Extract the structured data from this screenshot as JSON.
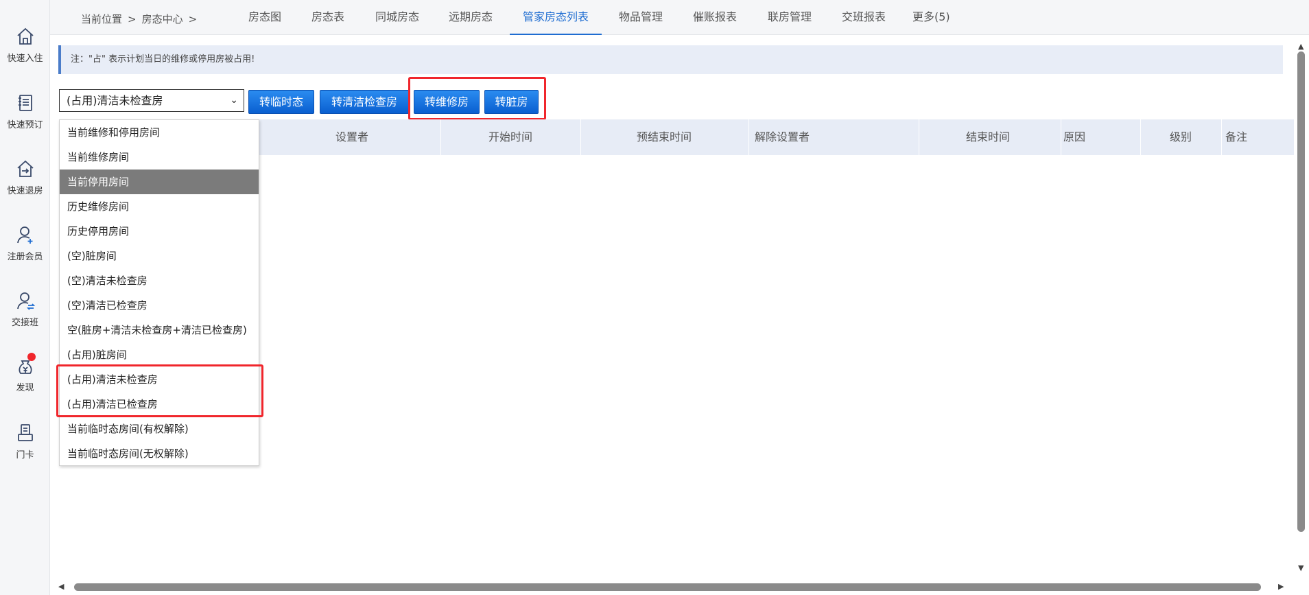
{
  "sidebar": {
    "items": [
      {
        "label": "快速入住",
        "icon": "home-icon"
      },
      {
        "label": "快速预订",
        "icon": "notebook-icon"
      },
      {
        "label": "快速退房",
        "icon": "home-exit-icon"
      },
      {
        "label": "注册会员",
        "icon": "user-add-icon"
      },
      {
        "label": "交接班",
        "icon": "user-swap-icon"
      },
      {
        "label": "发现",
        "icon": "money-bag-icon"
      },
      {
        "label": "门卡",
        "icon": "card-reader-icon"
      }
    ]
  },
  "breadcrumb": {
    "prefix": "当前位置",
    "sep": ">",
    "current": "房态中心"
  },
  "tabs": [
    "房态图",
    "房态表",
    "同城房态",
    "远期房态",
    "管家房态列表",
    "物品管理",
    "催账报表",
    "联房管理",
    "交班报表",
    "更多(5)"
  ],
  "active_tab": "管家房态列表",
  "note": "注：\"占\" 表示计划当日的维修或停用房被占用!",
  "filter": {
    "selected": "(占用)清洁未检查房",
    "options": [
      "当前维修和停用房间",
      "当前维修房间",
      "当前停用房间",
      "历史维修房间",
      "历史停用房间",
      "(空)脏房间",
      "(空)清洁未检查房",
      "(空)清洁已检查房",
      "空(脏房+清洁未检查房+清洁已检查房)",
      "(占用)脏房间",
      "(占用)清洁未检查房",
      "(占用)清洁已检查房",
      "当前临时态房间(有权解除)",
      "当前临时态房间(无权解除)"
    ],
    "highlighted_option": "当前停用房间"
  },
  "buttons": {
    "temp": "转临时态",
    "clean_checked": "转清洁检查房",
    "repair": "转维修房",
    "dirty": "转脏房"
  },
  "table": {
    "columns": [
      "设置者",
      "开始时间",
      "预结束时间",
      "解除设置者",
      "结束时间",
      "原因",
      "级别",
      "备注"
    ]
  },
  "colors": {
    "accent": "#1f6dd1",
    "highlight_box": "#f0262c",
    "button_blue": "#0a5fd0"
  }
}
